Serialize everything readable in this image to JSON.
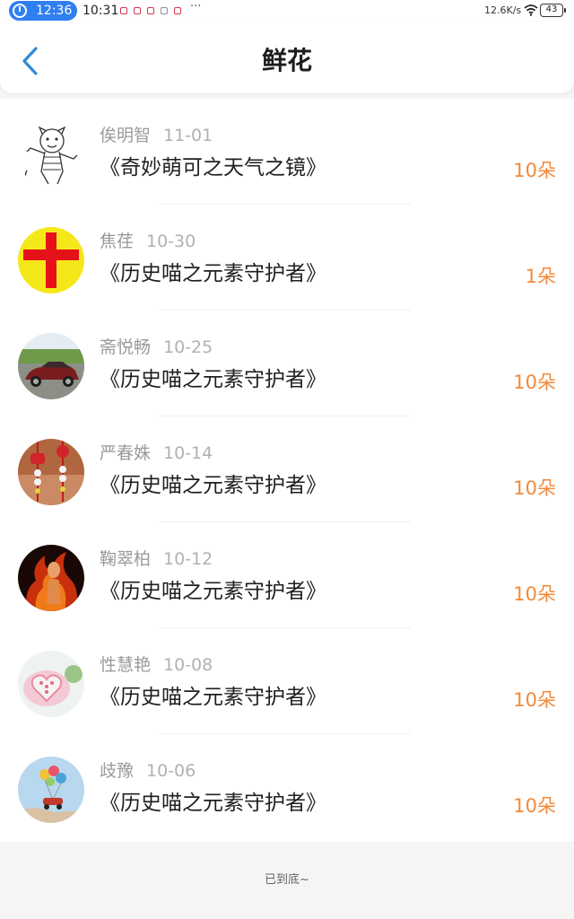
{
  "status_bar": {
    "timer": "12:36",
    "clock": "10:31",
    "more": "···",
    "net_speed": "12.6K/s",
    "battery": "43"
  },
  "header": {
    "title": "鲜花",
    "back_icon": "chevron-left-icon"
  },
  "items": [
    {
      "name": "俟明智",
      "date": "11-01",
      "work": "《奇妙萌可之天气之镜》",
      "count": "10朵",
      "avatar": "tiger-cartoon"
    },
    {
      "name": "焦荏",
      "date": "10-30",
      "work": "《历史喵之元素守护者》",
      "count": "1朵",
      "avatar": "red-cross"
    },
    {
      "name": "斋悦畅",
      "date": "10-25",
      "work": "《历史喵之元素守护者》",
      "count": "10朵",
      "avatar": "car-photo"
    },
    {
      "name": "严春姝",
      "date": "10-14",
      "work": "《历史喵之元素守护者》",
      "count": "10朵",
      "avatar": "chinese-knot-photo"
    },
    {
      "name": "鞠翠柏",
      "date": "10-12",
      "work": "《历史喵之元素守护者》",
      "count": "10朵",
      "avatar": "fire-woman-photo"
    },
    {
      "name": "性慧艳",
      "date": "10-08",
      "work": "《历史喵之元素守护者》",
      "count": "10朵",
      "avatar": "heart-cake-photo"
    },
    {
      "name": "歧豫",
      "date": "10-06",
      "work": "《历史喵之元素守护者》",
      "count": "10朵",
      "avatar": "balloon-car-photo"
    }
  ],
  "footer": {
    "end_text": "已到底~"
  },
  "colors": {
    "accent_blue": "#2f8ad8",
    "count_orange": "#f08a3c",
    "timer_pill": "#2f7ff0"
  }
}
